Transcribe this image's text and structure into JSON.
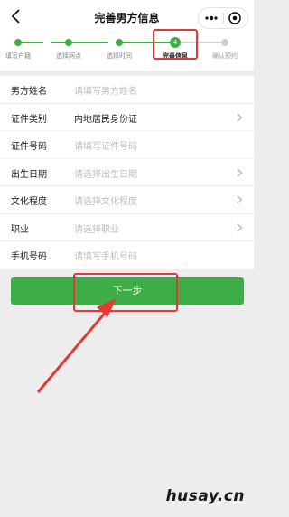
{
  "navbar": {
    "title": "完善男方信息",
    "back_icon": "chevron-left-icon",
    "more_icon": "more-dots-icon",
    "close_icon": "target-circle-icon"
  },
  "steps": [
    {
      "label": "填写户籍",
      "state": "done"
    },
    {
      "label": "选择网点",
      "state": "done"
    },
    {
      "label": "选择时间",
      "state": "done"
    },
    {
      "label": "完善信息",
      "state": "current",
      "number": "4"
    },
    {
      "label": "确认预约",
      "state": "pending"
    }
  ],
  "form": {
    "rows": [
      {
        "label": "男方姓名",
        "value": "请填写男方姓名",
        "filled": false,
        "chevron": false
      },
      {
        "label": "证件类别",
        "value": "内地居民身份证",
        "filled": true,
        "chevron": true
      },
      {
        "label": "证件号码",
        "value": "请填写证件号码",
        "filled": false,
        "chevron": false
      },
      {
        "label": "出生日期",
        "value": "请选择出生日期",
        "filled": false,
        "chevron": true
      },
      {
        "label": "文化程度",
        "value": "请选择文化程度",
        "filled": false,
        "chevron": true
      },
      {
        "label": "职业",
        "value": "请选择职业",
        "filled": false,
        "chevron": true
      },
      {
        "label": "手机号码",
        "value": "请填写手机号码",
        "filled": false,
        "chevron": false
      }
    ]
  },
  "next_button_label": "下一步",
  "watermark": "husay.cn",
  "colors": {
    "accent": "#3dae45",
    "annotation": "#e53935",
    "background": "#ededed"
  }
}
